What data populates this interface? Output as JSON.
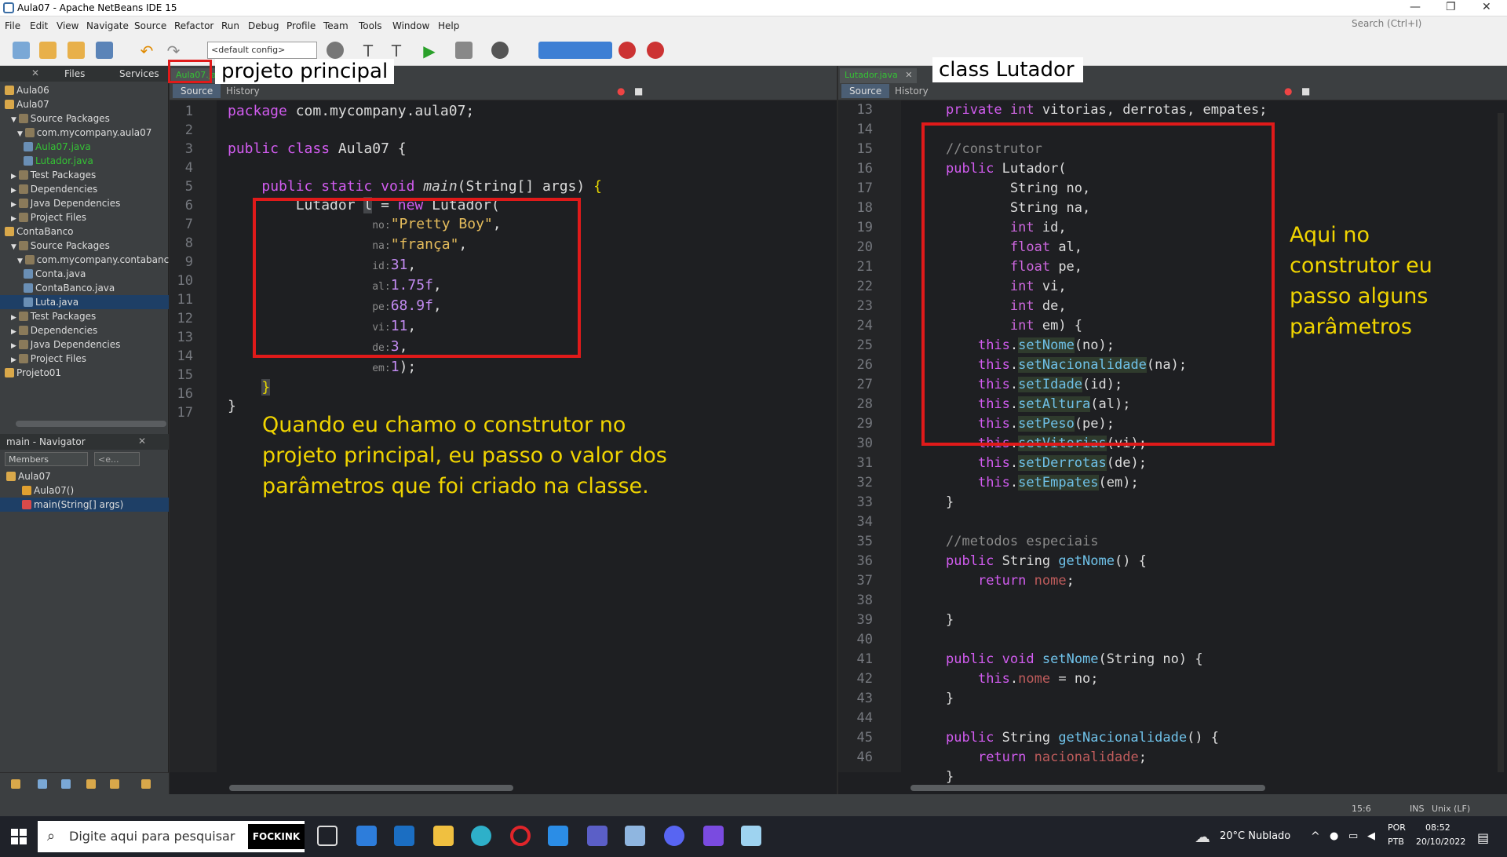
{
  "window": {
    "title": "Aula07 - Apache NetBeans IDE 15"
  },
  "menu": [
    "File",
    "Edit",
    "View",
    "Navigate",
    "Source",
    "Refactor",
    "Run",
    "Debug",
    "Profile",
    "Team",
    "Tools",
    "Window",
    "Help"
  ],
  "search_placeholder": "Search (Ctrl+I)",
  "toolbar": {
    "config": "<default config>"
  },
  "left_panel": {
    "tabs": [
      "Files",
      "Services"
    ],
    "tree": [
      {
        "label": "Aula06",
        "indent": 0,
        "arrow": ""
      },
      {
        "label": "Aula07",
        "indent": 0,
        "arrow": ""
      },
      {
        "label": "Source Packages",
        "indent": 1,
        "arrow": "▼"
      },
      {
        "label": "com.mycompany.aula07",
        "indent": 2,
        "arrow": "▼"
      },
      {
        "label": "Aula07.java",
        "indent": 3,
        "arrow": "",
        "green": true
      },
      {
        "label": "Lutador.java",
        "indent": 3,
        "arrow": "",
        "green": true
      },
      {
        "label": "Test Packages",
        "indent": 1,
        "arrow": "▶"
      },
      {
        "label": "Dependencies",
        "indent": 1,
        "arrow": "▶"
      },
      {
        "label": "Java Dependencies",
        "indent": 1,
        "arrow": "▶"
      },
      {
        "label": "Project Files",
        "indent": 1,
        "arrow": "▶"
      },
      {
        "label": "ContaBanco",
        "indent": 0,
        "arrow": ""
      },
      {
        "label": "Source Packages",
        "indent": 1,
        "arrow": "▼"
      },
      {
        "label": "com.mycompany.contabanco",
        "indent": 2,
        "arrow": "▼"
      },
      {
        "label": "Conta.java",
        "indent": 3,
        "arrow": ""
      },
      {
        "label": "ContaBanco.java",
        "indent": 3,
        "arrow": ""
      },
      {
        "label": "Luta.java",
        "indent": 3,
        "arrow": "",
        "selected": true
      },
      {
        "label": "Test Packages",
        "indent": 1,
        "arrow": "▶"
      },
      {
        "label": "Dependencies",
        "indent": 1,
        "arrow": "▶"
      },
      {
        "label": "Java Dependencies",
        "indent": 1,
        "arrow": "▶"
      },
      {
        "label": "Project Files",
        "indent": 1,
        "arrow": "▶"
      },
      {
        "label": "Projeto01",
        "indent": 0,
        "arrow": ""
      }
    ]
  },
  "navigator": {
    "title": "main - Navigator",
    "filter": "Members",
    "filter2": "<e...",
    "items": [
      {
        "label": "Aula07",
        "indent": 0
      },
      {
        "label": "Aula07()",
        "indent": 1
      },
      {
        "label": "main(String[] args)",
        "indent": 1,
        "selected": true
      }
    ]
  },
  "editor_left": {
    "tab": "Aula07.java",
    "source_tab": "Source",
    "history_tab": "History",
    "label": "projeto principal",
    "line_numbers": [
      "1",
      "2",
      "3",
      "4",
      "5",
      "6",
      "7",
      "8",
      "9",
      "10",
      "11",
      "12",
      "13",
      "14",
      "15",
      "16",
      "17"
    ],
    "annotation": "Quando eu chamo o construtor no projeto principal, eu passo o valor dos parâmetros que foi criado na classe."
  },
  "editor_right": {
    "tab": "Lutador.java",
    "source_tab": "Source",
    "history_tab": "History",
    "label": "class Lutador",
    "line_numbers": [
      "13",
      "14",
      "15",
      "16",
      "17",
      "18",
      "19",
      "20",
      "21",
      "22",
      "23",
      "24",
      "25",
      "26",
      "27",
      "28",
      "29",
      "30",
      "31",
      "32",
      "33",
      "34",
      "35",
      "36",
      "37",
      "38",
      "39",
      "40",
      "41",
      "42",
      "43",
      "44",
      "45",
      "46"
    ],
    "annotation": "Aqui no construtor eu passo alguns parâmetros"
  },
  "status": {
    "position": "15:6",
    "mode": "INS",
    "eol": "Unix (LF)"
  },
  "taskbar": {
    "search": "Digite aqui para pesquisar",
    "app_badge": "FOCKINK",
    "weather": "20°C  Nublado",
    "lang1": "POR",
    "lang2": "PTB",
    "time": "08:52",
    "date": "20/10/2022"
  }
}
